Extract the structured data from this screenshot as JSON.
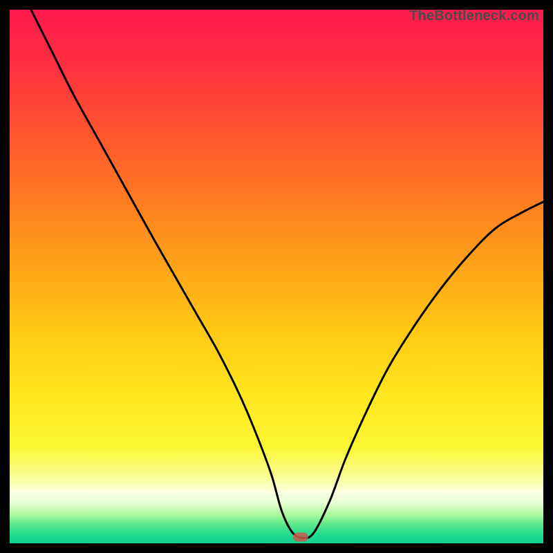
{
  "watermark": "TheBottleneck.com",
  "gradient": {
    "stops": [
      {
        "offset": 0.0,
        "color": "#ff1a4c"
      },
      {
        "offset": 0.1,
        "color": "#ff2e42"
      },
      {
        "offset": 0.22,
        "color": "#ff5130"
      },
      {
        "offset": 0.35,
        "color": "#ff7a22"
      },
      {
        "offset": 0.48,
        "color": "#ffa318"
      },
      {
        "offset": 0.6,
        "color": "#ffc814"
      },
      {
        "offset": 0.72,
        "color": "#ffe61e"
      },
      {
        "offset": 0.82,
        "color": "#fcf633"
      },
      {
        "offset": 0.88,
        "color": "#faffa0"
      },
      {
        "offset": 0.905,
        "color": "#fbffe3"
      },
      {
        "offset": 0.925,
        "color": "#e6ffd0"
      },
      {
        "offset": 0.945,
        "color": "#aef8a0"
      },
      {
        "offset": 0.965,
        "color": "#5de88b"
      },
      {
        "offset": 0.985,
        "color": "#1fd98e"
      },
      {
        "offset": 1.0,
        "color": "#12d08e"
      }
    ]
  },
  "marker": {
    "x_frac": 0.545,
    "y_frac": 0.988
  },
  "chart_data": {
    "type": "line",
    "title": "",
    "xlabel": "",
    "ylabel": "",
    "xlim": [
      0,
      100
    ],
    "ylim": [
      0,
      100
    ],
    "series": [
      {
        "name": "bottleneck-curve",
        "x": [
          4,
          8,
          12,
          17,
          22,
          27,
          31,
          35,
          39,
          43,
          46,
          49,
          51,
          53,
          55,
          57,
          60,
          63,
          67,
          71,
          76,
          81,
          86,
          91,
          96,
          100
        ],
        "y": [
          100,
          92,
          84,
          75,
          66,
          57,
          50,
          43,
          36,
          28,
          21,
          13,
          6,
          2,
          1,
          2,
          8,
          16,
          25,
          33,
          41,
          48,
          54,
          59,
          62,
          64
        ]
      }
    ],
    "annotations": [
      {
        "type": "marker",
        "x": 54.5,
        "y": 1.2,
        "label": "optimal-point"
      }
    ]
  }
}
